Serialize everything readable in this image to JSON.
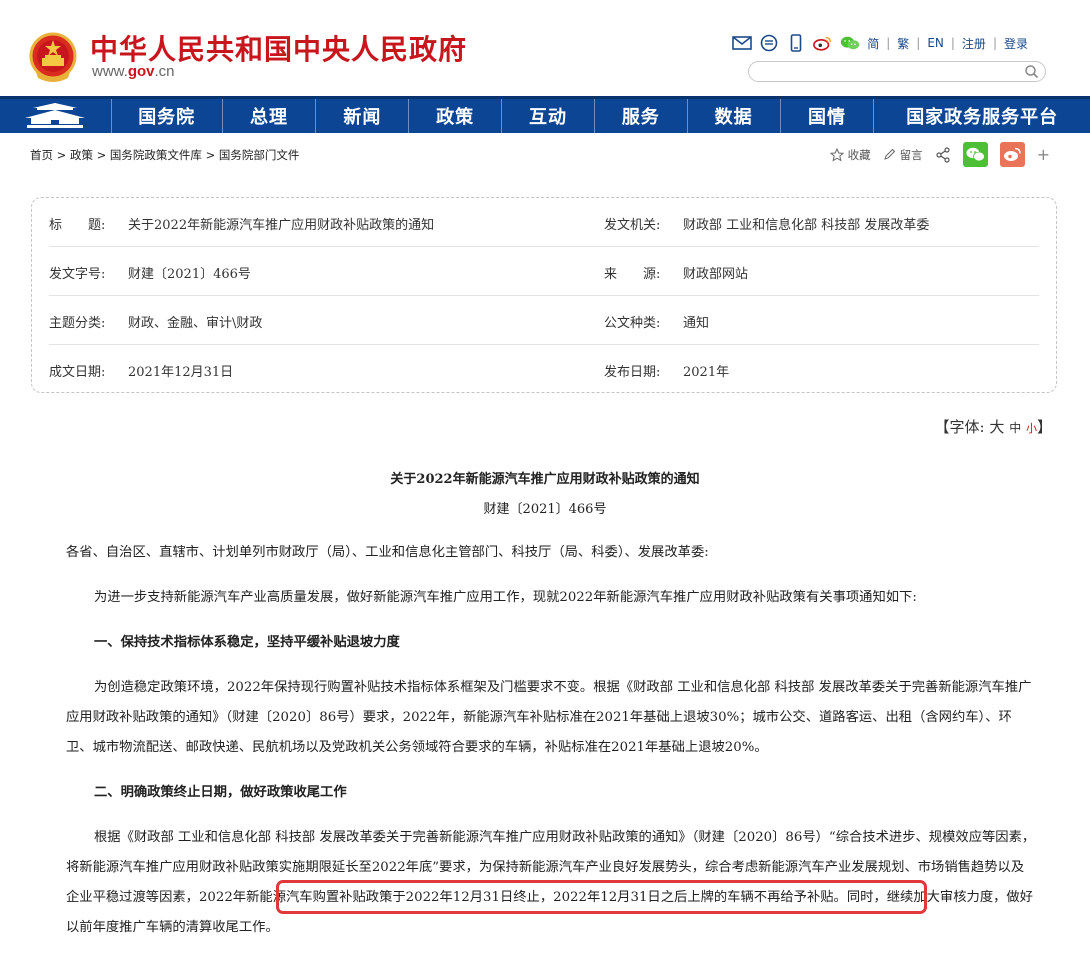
{
  "header": {
    "site_title": "中华人民共和国中央人民政府",
    "site_url_prefix": "www.",
    "site_url_brand": "gov",
    "site_url_suffix": ".cn",
    "links": {
      "simplified": "简",
      "traditional": "繁",
      "english": "EN",
      "register": "注册",
      "login": "登录"
    },
    "search_placeholder": ""
  },
  "nav": {
    "items": [
      "国务院",
      "总理",
      "新闻",
      "政策",
      "互动",
      "服务",
      "数据",
      "国情",
      "国家政务服务平台"
    ]
  },
  "breadcrumb": {
    "items": [
      "首页",
      "政策",
      "国务院政策文件库",
      "国务院部门文件"
    ],
    "separator": ">"
  },
  "tools": {
    "favorite": "收藏",
    "comment": "留言",
    "plus": "+"
  },
  "info": {
    "rows": [
      {
        "label1": "标　　题:",
        "value1": "关于2022年新能源汽车推广应用财政补贴政策的通知",
        "label2": "发文机关:",
        "value2": "财政部 工业和信息化部 科技部 发展改革委"
      },
      {
        "label1": "发文字号:",
        "value1": "财建〔2021〕466号",
        "label2": "来　　源:",
        "value2": "财政部网站"
      },
      {
        "label1": "主题分类:",
        "value1": "财政、金融、审计\\财政",
        "label2": "公文种类:",
        "value2": "通知"
      },
      {
        "label1": "成文日期:",
        "value1": "2021年12月31日",
        "label2": "发布日期:",
        "value2": "2021年"
      }
    ]
  },
  "font_size": {
    "open": "【字体:",
    "large": "大",
    "medium": "中",
    "small": "小",
    "close": "】"
  },
  "article": {
    "title": "关于2022年新能源汽车推广应用财政补贴政策的通知",
    "doc_number": "财建〔2021〕466号",
    "salutation": "各省、自治区、直辖市、计划单列市财政厅（局）、工业和信息化主管部门、科技厅（局、科委）、发展改革委:",
    "intro": "为进一步支持新能源汽车产业高质量发展，做好新能源汽车推广应用工作，现就2022年新能源汽车推广应用财政补贴政策有关事项通知如下:",
    "heading1": "一、保持技术指标体系稳定，坚持平缓补贴退坡力度",
    "para1": "为创造稳定政策环境，2022年保持现行购置补贴技术指标体系框架及门槛要求不变。根据《财政部 工业和信息化部 科技部 发展改革委关于完善新能源汽车推广应用财政补贴政策的通知》（财建〔2020〕86号）要求，2022年，新能源汽车补贴标准在2021年基础上退坡30%；城市公交、道路客运、出租（含网约车）、环卫、城市物流配送、邮政快递、民航机场以及党政机关公务领域符合要求的车辆，补贴标准在2021年基础上退坡20%。",
    "heading2": "二、明确政策终止日期，做好政策收尾工作",
    "para2": "根据《财政部 工业和信息化部 科技部 发展改革委关于完善新能源汽车推广应用财政补贴政策的通知》（财建〔2020〕86号）“综合技术进步、规模效应等因素，将新能源汽车推广应用财政补贴政策实施期限延长至2022年底”要求，为保持新能源汽车产业良好发展势头，综合考虑新能源汽车产业发展规划、市场销售趋势以及企业平稳过渡等因素，2022年新能源汽车购置补贴政策于2022年12月31日终止，2022年12月31日之后上牌的车辆不再给予补贴。同时，继续加大审核力度，做好以前年度推广车辆的清算收尾工作。"
  },
  "colors": {
    "brand_red": "#c8161d",
    "nav_blue": "#0d4595",
    "highlight_red": "#e1383a",
    "wechat_green": "#4cbf34",
    "weibo_orange": "#e9745a"
  }
}
